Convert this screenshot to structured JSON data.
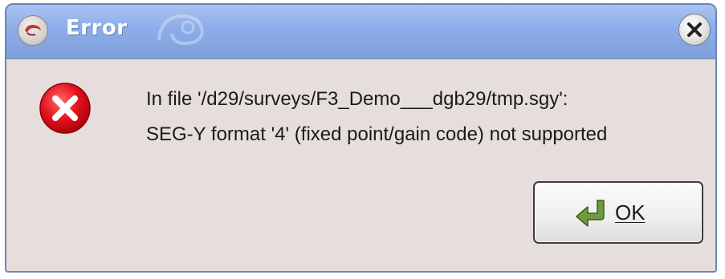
{
  "window": {
    "title": "Error",
    "icons": {
      "app": "window-app-icon",
      "close": "close-icon",
      "message": "error-icon"
    }
  },
  "message": {
    "line1": "In file '/d29/surveys/F3_Demo___dgb29/tmp.sgy':",
    "line2": "SEG-Y format '4' (fixed point/gain code) not supported"
  },
  "ok_button": {
    "label": "OK",
    "icon": "enter-arrow-icon"
  },
  "colors": {
    "titlebar": "#8cadea",
    "dialog_bg": "#e6dedd",
    "error_red": "#e3101b"
  }
}
